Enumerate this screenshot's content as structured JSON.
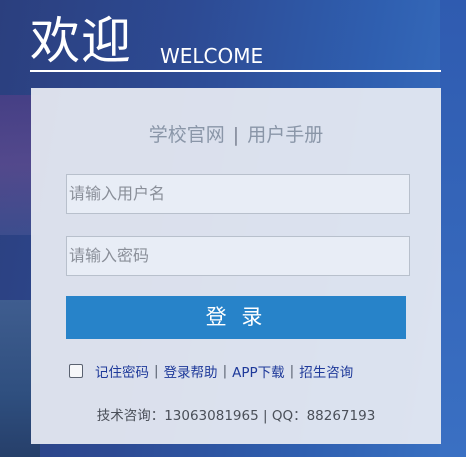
{
  "header": {
    "title_cn": "欢迎",
    "title_en": "WELCOME"
  },
  "panel": {
    "link_school": "学校官网",
    "link_separator": "|",
    "link_manual": "用户手册",
    "username_placeholder": "请输入用户名",
    "password_placeholder": "请输入密码",
    "login_label": "登 录",
    "remember_label": "记住密码",
    "help_label": "登录帮助",
    "app_label": "APP下载",
    "admission_label": "招生咨询",
    "option_separator": "|",
    "support_text": "技术咨询：13063081965 | QQ：88267193"
  },
  "colors": {
    "accent": "#2783c9",
    "link": "#1f3a9a",
    "background": "#2d4a93"
  }
}
